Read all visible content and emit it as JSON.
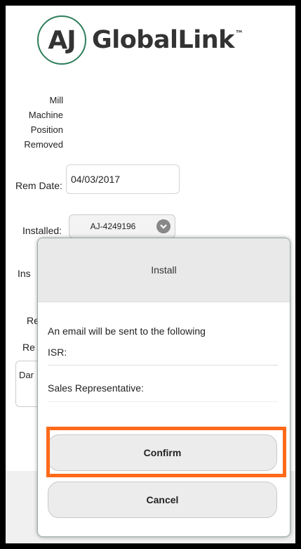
{
  "brand": {
    "mark": "AJ",
    "name": "GlobalLink",
    "tm": "™"
  },
  "details": {
    "lines": [
      "Mill",
      "Machine",
      "Position",
      "Removed"
    ]
  },
  "form": {
    "rem_date_label": "Rem Date:",
    "rem_date_value": "04/03/2017",
    "installed_label": "Installed:",
    "installed_value": "AJ-4249196",
    "obscured_label_1": "Ins",
    "obscured_label_2": "Re",
    "obscured_label_3": "Re",
    "obscured_box_text": "Dar"
  },
  "modal": {
    "title": "Install",
    "message": "An email will be sent to the following",
    "isr_label": "ISR:",
    "sales_rep_label": "Sales Representative:",
    "confirm_label": "Confirm",
    "cancel_label": "Cancel"
  },
  "colors": {
    "highlight": "#ff6a1a",
    "logo_ring": "#2e7d5b"
  }
}
